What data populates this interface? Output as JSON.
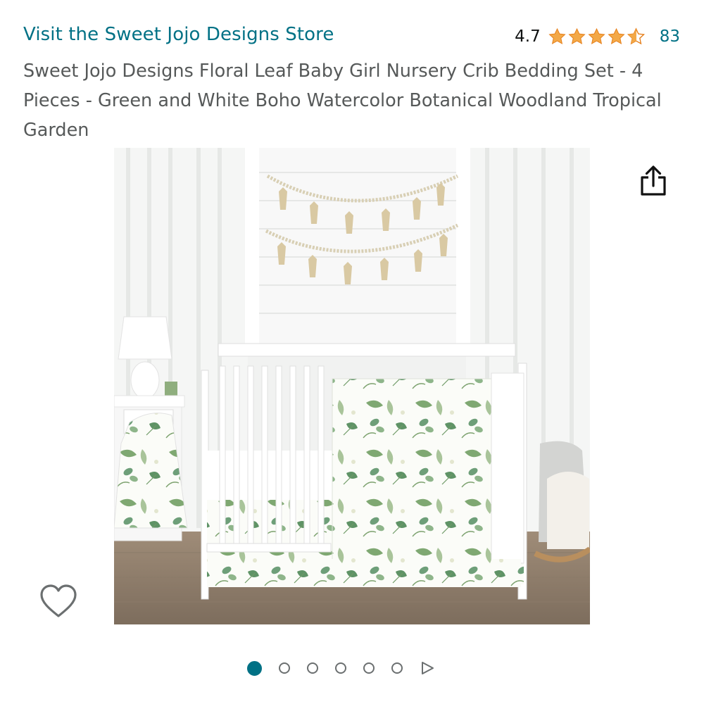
{
  "store": {
    "link_text": "Visit the Sweet Jojo Designs Store"
  },
  "rating": {
    "value": "4.7",
    "stars_out_of_5": 4.7,
    "count": "83",
    "star_color": "#F3A847"
  },
  "product": {
    "title": "Sweet Jojo Designs Floral Leaf Baby Girl Nursery Crib Bedding Set - 4 Pieces - Green and White Boho Watercolor Botanical Woodland Tropical Garden"
  },
  "image": {
    "alt": ""
  },
  "icons": {
    "share": "share-icon",
    "wishlist": "heart-outline-icon",
    "carousel_next": "play-triangle-icon"
  },
  "carousel": {
    "total_dots": 6,
    "active_index": 0
  },
  "colors": {
    "link": "#007185",
    "text_secondary": "#565959",
    "star": "#F3A847"
  }
}
